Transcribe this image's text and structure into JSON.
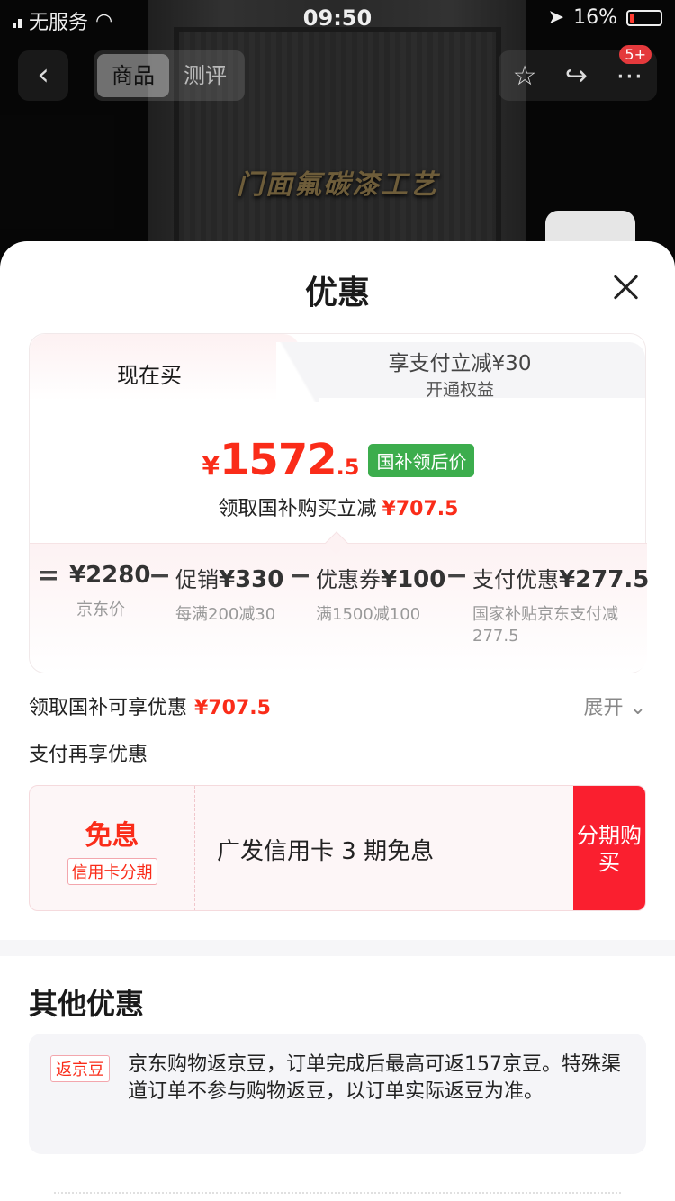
{
  "background": {
    "caption": "门面氟碳漆工艺",
    "status": {
      "carrier": "无服务",
      "time": "09:50",
      "battery": "16%"
    },
    "nav": {
      "tabs": [
        "商品",
        "测评"
      ],
      "badge": "5+"
    }
  },
  "sheet": {
    "title": "优惠",
    "tabs": {
      "now": "现在买",
      "pay_line1": "享支付立减¥30",
      "pay_line2": "开通权益"
    },
    "price": {
      "currency": "¥",
      "integer": "1572",
      "decimal": ".5",
      "tag": "国补领后价"
    },
    "saving": {
      "label": "领取国补购买立减",
      "amount": "¥707.5"
    },
    "breakdown": {
      "items": [
        {
          "label": "",
          "amount": "¥2280",
          "desc": "京东价"
        },
        {
          "label": "促销",
          "amount": "¥330",
          "desc": "每满200减30"
        },
        {
          "label": "优惠券",
          "amount": "¥100",
          "desc": "满1500减100"
        },
        {
          "label": "支付优惠",
          "amount": "¥277.5",
          "desc": "国家补贴京东支付减277.5"
        }
      ],
      "ops": [
        "=",
        "−",
        "−",
        "−"
      ]
    },
    "gov_row": {
      "label": "领取国补可享优惠",
      "amount": "¥707.5",
      "expand": "展开"
    },
    "pay_title": "支付再享优惠",
    "credit": {
      "free": "免息",
      "tag": "信用卡分期",
      "text": "广发信用卡 3 期免息",
      "button": "分期购买"
    },
    "other": {
      "title": "其他优惠",
      "tag": "返京豆",
      "text": "京东购物返京豆，订单完成后最高可返157京豆。特殊渠道订单不参与购物返豆，以订单实际返豆为准。"
    }
  }
}
